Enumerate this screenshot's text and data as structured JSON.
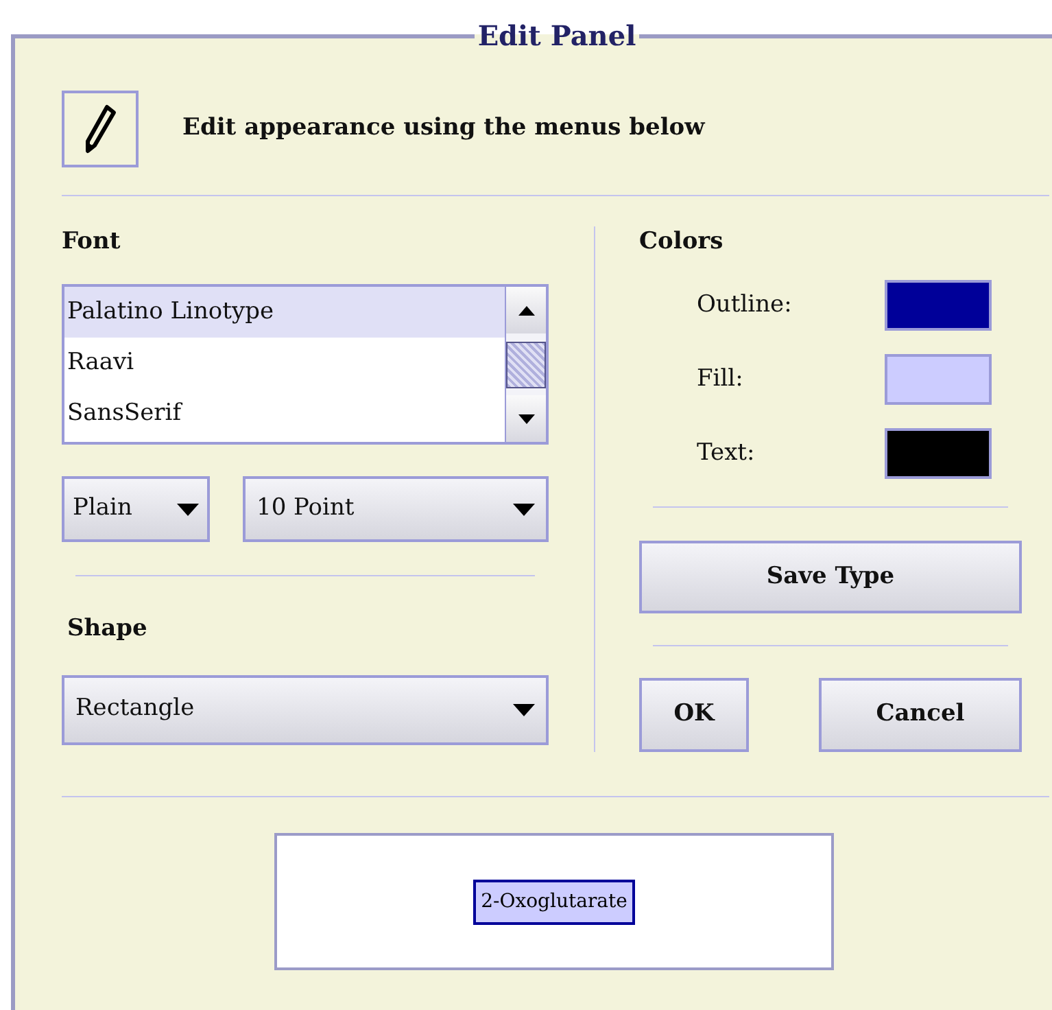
{
  "panel": {
    "title": "Edit Panel"
  },
  "header": {
    "text": "Edit appearance using the menus below"
  },
  "font": {
    "label": "Font",
    "list": [
      {
        "name": "Palatino Linotype",
        "selected": true
      },
      {
        "name": "Raavi",
        "selected": false
      },
      {
        "name": "SansSerif",
        "selected": false
      }
    ],
    "style": "Plain",
    "size": "10 Point"
  },
  "shape": {
    "label": "Shape",
    "value": "Rectangle"
  },
  "colors": {
    "label": "Colors",
    "items": [
      {
        "label": "Outline:",
        "color": "#000099"
      },
      {
        "label": "Fill:",
        "color": "#ccccff"
      },
      {
        "label": "Text:",
        "color": "#000000"
      }
    ]
  },
  "buttons": {
    "save": "Save Type",
    "ok": "OK",
    "cancel": "Cancel"
  },
  "preview": {
    "label": "2-Oxoglutarate"
  }
}
